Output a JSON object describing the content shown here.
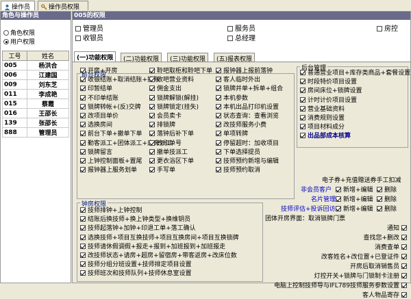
{
  "top_tabs": [
    {
      "label": "操作员",
      "icon": "user-icon"
    },
    {
      "label": "操作员权限",
      "icon": "key-icon"
    }
  ],
  "left_panel": {
    "title": "角色与操作员",
    "radio_role": "角色权限",
    "radio_user": "用户权限",
    "columns": [
      "工号",
      "姓名"
    ],
    "rows": [
      {
        "id": "005",
        "name": "杨洪合"
      },
      {
        "id": "006",
        "name": "江建国"
      },
      {
        "id": "009",
        "name": "刘东芝"
      },
      {
        "id": "011",
        "name": "李成艳"
      },
      {
        "id": "015",
        "name": "蔡霞"
      },
      {
        "id": "016",
        "name": "王邵长"
      },
      {
        "id": "139",
        "name": "张邵长"
      },
      {
        "id": "888",
        "name": "管理员"
      }
    ]
  },
  "right_panel": {
    "title": "005的权限",
    "roles": [
      "管理员",
      "服务员",
      "房控",
      "收银员",
      "总经理"
    ],
    "tabs": [
      "(一)功能权限",
      "(二)功能权限",
      "(三)功能权限",
      "(五)报表权限"
    ],
    "front": {
      "title": "前台权限",
      "col1": [
        "开房+开房",
        "收银结账+取消结账+撤账",
        "印暂结单",
        "不印单结账",
        "锁牌转帐+(反)交牌",
        "改项目单价",
        "选换房间",
        "前台下单+撤单下单",
        "勤客派工+团体派工+床旁派工",
        "锁牌留言",
        "上钟控制面板+置尾",
        "报钟器上服务划单"
      ],
      "col2": [
        "聆吧取柜和聆吧下单",
        "收吧营业资料",
        "佣金支出",
        "锁牌解锁(解挂)",
        "锁牌锁定(挂失)",
        "会员卖卡",
        "排锁牌",
        "落钟后补下单",
        "改卡单号",
        "撤单技派工",
        "更衣浴区下单",
        "手写单"
      ],
      "col3": [
        "报钟器上报前落钟",
        "客人临时外出",
        "锁牌并单+拆单+组合",
        "本机参数",
        "本机出品打印机设置",
        "状态查询：查看浏览",
        "改技师服务小费",
        "单项转牌",
        "停留超时：加收项目",
        "下单选择提员",
        "技师预约新增与编辑",
        "技师预约取消"
      ],
      "col1_extra": "收点救援金"
    },
    "back": {
      "title": "后台管理",
      "items": [
        "普通营业项目+库存类商品+套餐设置",
        "时段特价项目设置",
        "房间床位+锁牌设置",
        "计时计价项目设置",
        "营业基础资料",
        "消费规则设置",
        "项目材料成分",
        "出品部成本核算"
      ]
    },
    "misc": {
      "voucher": "电子券+充值赠送券手工扣减",
      "member_label": "非会员客户",
      "card_label": "名片管理",
      "add_edit": "新增+编辑",
      "delete": "删除",
      "tech_eval": "技师评估+投诉回访",
      "group_label": "团体开房界面：取消锁牌门票",
      "right_list": [
        "新增+编辑",
        "删除",
        "通知",
        "查找您+删改",
        "消费查单",
        "改客姓名+改位置+已登证件",
        "开房后取消销售员",
        "灯控开关+锁牌与门锁制卡注册",
        "电脑上控制技师导与IFL789技师服务参数设置",
        "客人物品寄存"
      ]
    },
    "tech": {
      "title": "钟房权限",
      "items": [
        "技师排钟+上钟控制",
        "结账后换技师+换上钟类型+换维钥员",
        "技师起落钟+加钟+印退工单+落工确认",
        "选换技师+项目互换技师+项目互换房间+项目互换锁牌",
        "技师请休假调假+报走+报到+加班报到+加班报走",
        "改技师状态+请房+超房+留宿房+带客返房+改床位数",
        "技师分组分班设置+技师排定项目设置",
        "技师班次和技师队列+技师休息室设置"
      ]
    }
  }
}
